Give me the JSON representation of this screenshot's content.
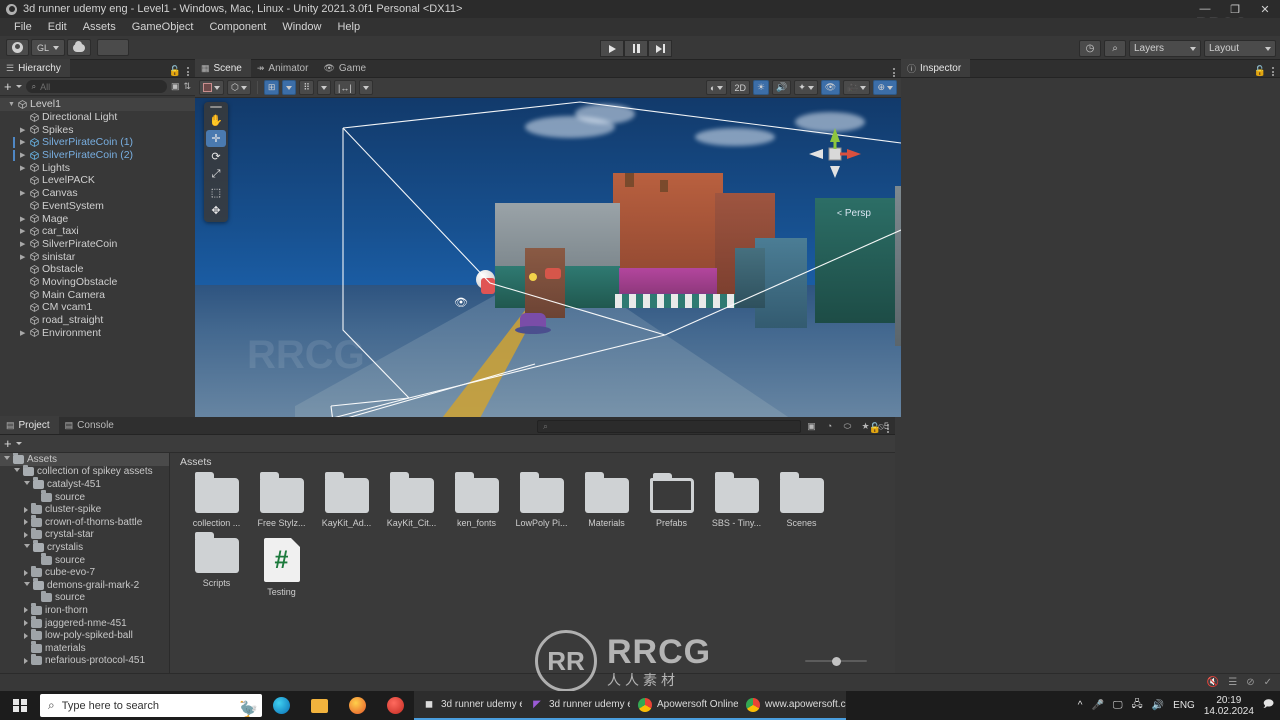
{
  "window": {
    "title": "3d runner udemy eng - Level1 - Windows, Mac, Linux - Unity 2021.3.0f1 Personal <DX11>",
    "minimize": "—",
    "maximize": "❐",
    "close": "✕",
    "watermark": "RRCG.cn"
  },
  "menu": [
    "File",
    "Edit",
    "Assets",
    "GameObject",
    "Component",
    "Window",
    "Help"
  ],
  "toolbar": {
    "account_label": "GL",
    "play": "play-icon",
    "pause": "pause-icon",
    "step": "step-icon",
    "history_icon": "history-icon",
    "search_icon": "search-icon",
    "layers": "Layers",
    "layout": "Layout"
  },
  "hierarchy": {
    "tab": "Hierarchy",
    "search_placeholder": "All",
    "items": [
      {
        "label": "Level1",
        "depth": 0,
        "arrow": "down",
        "selected": false,
        "root": true
      },
      {
        "label": "Directional Light",
        "depth": 1,
        "arrow": "none",
        "selected": false
      },
      {
        "label": "Spikes",
        "depth": 1,
        "arrow": "right",
        "selected": false
      },
      {
        "label": "SilverPirateCoin (1)",
        "depth": 1,
        "arrow": "right",
        "selected": true
      },
      {
        "label": "SilverPirateCoin (2)",
        "depth": 1,
        "arrow": "right",
        "selected": true
      },
      {
        "label": "Lights",
        "depth": 1,
        "arrow": "right",
        "selected": false
      },
      {
        "label": "LevelPACK",
        "depth": 1,
        "arrow": "none",
        "selected": false
      },
      {
        "label": "Canvas",
        "depth": 1,
        "arrow": "right",
        "selected": false
      },
      {
        "label": "EventSystem",
        "depth": 1,
        "arrow": "none",
        "selected": false
      },
      {
        "label": "Mage",
        "depth": 1,
        "arrow": "right",
        "selected": false
      },
      {
        "label": "car_taxi",
        "depth": 1,
        "arrow": "right",
        "selected": false
      },
      {
        "label": "SilverPirateCoin",
        "depth": 1,
        "arrow": "right",
        "selected": false
      },
      {
        "label": "sinistar",
        "depth": 1,
        "arrow": "right",
        "selected": false
      },
      {
        "label": "Obstacle",
        "depth": 1,
        "arrow": "none",
        "selected": false
      },
      {
        "label": "MovingObstacle",
        "depth": 1,
        "arrow": "none",
        "selected": false
      },
      {
        "label": "Main Camera",
        "depth": 1,
        "arrow": "none",
        "selected": false
      },
      {
        "label": "CM vcam1",
        "depth": 1,
        "arrow": "none",
        "selected": false
      },
      {
        "label": "road_straight",
        "depth": 1,
        "arrow": "none",
        "selected": false
      },
      {
        "label": "Environment",
        "depth": 1,
        "arrow": "right",
        "selected": false
      }
    ]
  },
  "scene": {
    "tabs": [
      {
        "label": "Scene",
        "icon": "grid-icon",
        "active": true
      },
      {
        "label": "Animator",
        "icon": "animator-icon",
        "active": false
      },
      {
        "label": "Game",
        "icon": "gamepad-icon",
        "active": false
      }
    ],
    "toolbar": {
      "shading": "shading-mode-icon",
      "draw_mode": "draw-mode-icon",
      "audio_2d": "2D",
      "lighting": "lighting-icon",
      "audio": "audio-icon",
      "fx": "effects-icon",
      "scene_vis": "scene-visibility-icon",
      "camera": "camera-settings-icon",
      "gizmos": "gizmos-icon"
    },
    "tools": [
      "hand-tool",
      "move-tool",
      "rotate-tool",
      "scale-tool",
      "rect-tool",
      "transform-tool"
    ],
    "active_tool": "move-tool",
    "gizmo_label": "Persp",
    "gizmo_axes": {
      "x": "x",
      "y": "y",
      "z": "z"
    },
    "watermark": "RRCG"
  },
  "inspector": {
    "tab": "Inspector"
  },
  "project": {
    "tabs": [
      {
        "label": "Project",
        "icon": "folder-icon",
        "active": true
      },
      {
        "label": "Console",
        "icon": "console-icon",
        "active": false
      }
    ],
    "search_placeholder": "",
    "breadcrumb": "Assets",
    "tree": [
      {
        "label": "Assets",
        "depth": 0,
        "arrow": "down",
        "open": true,
        "selected": true
      },
      {
        "label": "collection of spikey assets",
        "depth": 1,
        "arrow": "down",
        "open": true
      },
      {
        "label": "catalyst-451",
        "depth": 2,
        "arrow": "down",
        "open": true
      },
      {
        "label": "source",
        "depth": 3,
        "arrow": "none"
      },
      {
        "label": "cluster-spike",
        "depth": 2,
        "arrow": "right"
      },
      {
        "label": "crown-of-thorns-battle",
        "depth": 2,
        "arrow": "right"
      },
      {
        "label": "crystal-star",
        "depth": 2,
        "arrow": "right"
      },
      {
        "label": "crystalis",
        "depth": 2,
        "arrow": "down",
        "open": true
      },
      {
        "label": "source",
        "depth": 3,
        "arrow": "none"
      },
      {
        "label": "cube-evo-7",
        "depth": 2,
        "arrow": "right"
      },
      {
        "label": "demons-grail-mark-2",
        "depth": 2,
        "arrow": "down",
        "open": true
      },
      {
        "label": "source",
        "depth": 3,
        "arrow": "none"
      },
      {
        "label": "iron-thorn",
        "depth": 2,
        "arrow": "right"
      },
      {
        "label": "jaggered-nme-451",
        "depth": 2,
        "arrow": "right"
      },
      {
        "label": "low-poly-spiked-ball",
        "depth": 2,
        "arrow": "right"
      },
      {
        "label": "materials",
        "depth": 2,
        "arrow": "none"
      },
      {
        "label": "nefarious-protocol-451",
        "depth": 2,
        "arrow": "right"
      }
    ],
    "items": [
      {
        "name": "collection ...",
        "type": "folder"
      },
      {
        "name": "Free Stylz...",
        "type": "folder"
      },
      {
        "name": "KayKit_Ad...",
        "type": "folder"
      },
      {
        "name": "KayKit_Cit...",
        "type": "folder"
      },
      {
        "name": "ken_fonts",
        "type": "folder"
      },
      {
        "name": "LowPoly Pi...",
        "type": "folder"
      },
      {
        "name": "Materials",
        "type": "folder"
      },
      {
        "name": "Prefabs",
        "type": "folder-empty"
      },
      {
        "name": "SBS - Tiny...",
        "type": "folder"
      },
      {
        "name": "Scenes",
        "type": "folder"
      },
      {
        "name": "Scripts",
        "type": "folder"
      },
      {
        "name": "Testing",
        "type": "script"
      }
    ],
    "hidden_count": "5",
    "icons": [
      "save-search-icon",
      "filter-type-icon",
      "filter-label-icon",
      "favorite-icon",
      "hidden-packages-icon"
    ]
  },
  "statusbar": {
    "icons": [
      "mute-audio-icon",
      "layers-status-icon",
      "no-preview-icon",
      "check-icon"
    ]
  },
  "taskbar": {
    "search_placeholder": "Type here to search",
    "apps": [
      {
        "label": "3d runner udemy e...",
        "icon": "unity-icon"
      },
      {
        "label": "3d runner udemy e...",
        "icon": "visual-studio-icon"
      },
      {
        "label": "Apowersoft Online ...",
        "icon": "chrome-icon"
      },
      {
        "label": "www.apowersoft.c...",
        "icon": "chrome-icon"
      }
    ],
    "launchers": [
      "edge-icon",
      "file-explorer-icon",
      "firefox-icon",
      "opera-icon"
    ],
    "tray": {
      "chevron": "^",
      "mic": "mic-icon",
      "display": "display-icon",
      "network": "network-icon",
      "volume": "volume-icon",
      "language": "ENG",
      "time": "20:19",
      "date": "14.02.2024",
      "notifications": "notification-icon"
    }
  },
  "watermark_center": {
    "logo": "RR",
    "big": "RRCG",
    "small": "人人素材"
  }
}
